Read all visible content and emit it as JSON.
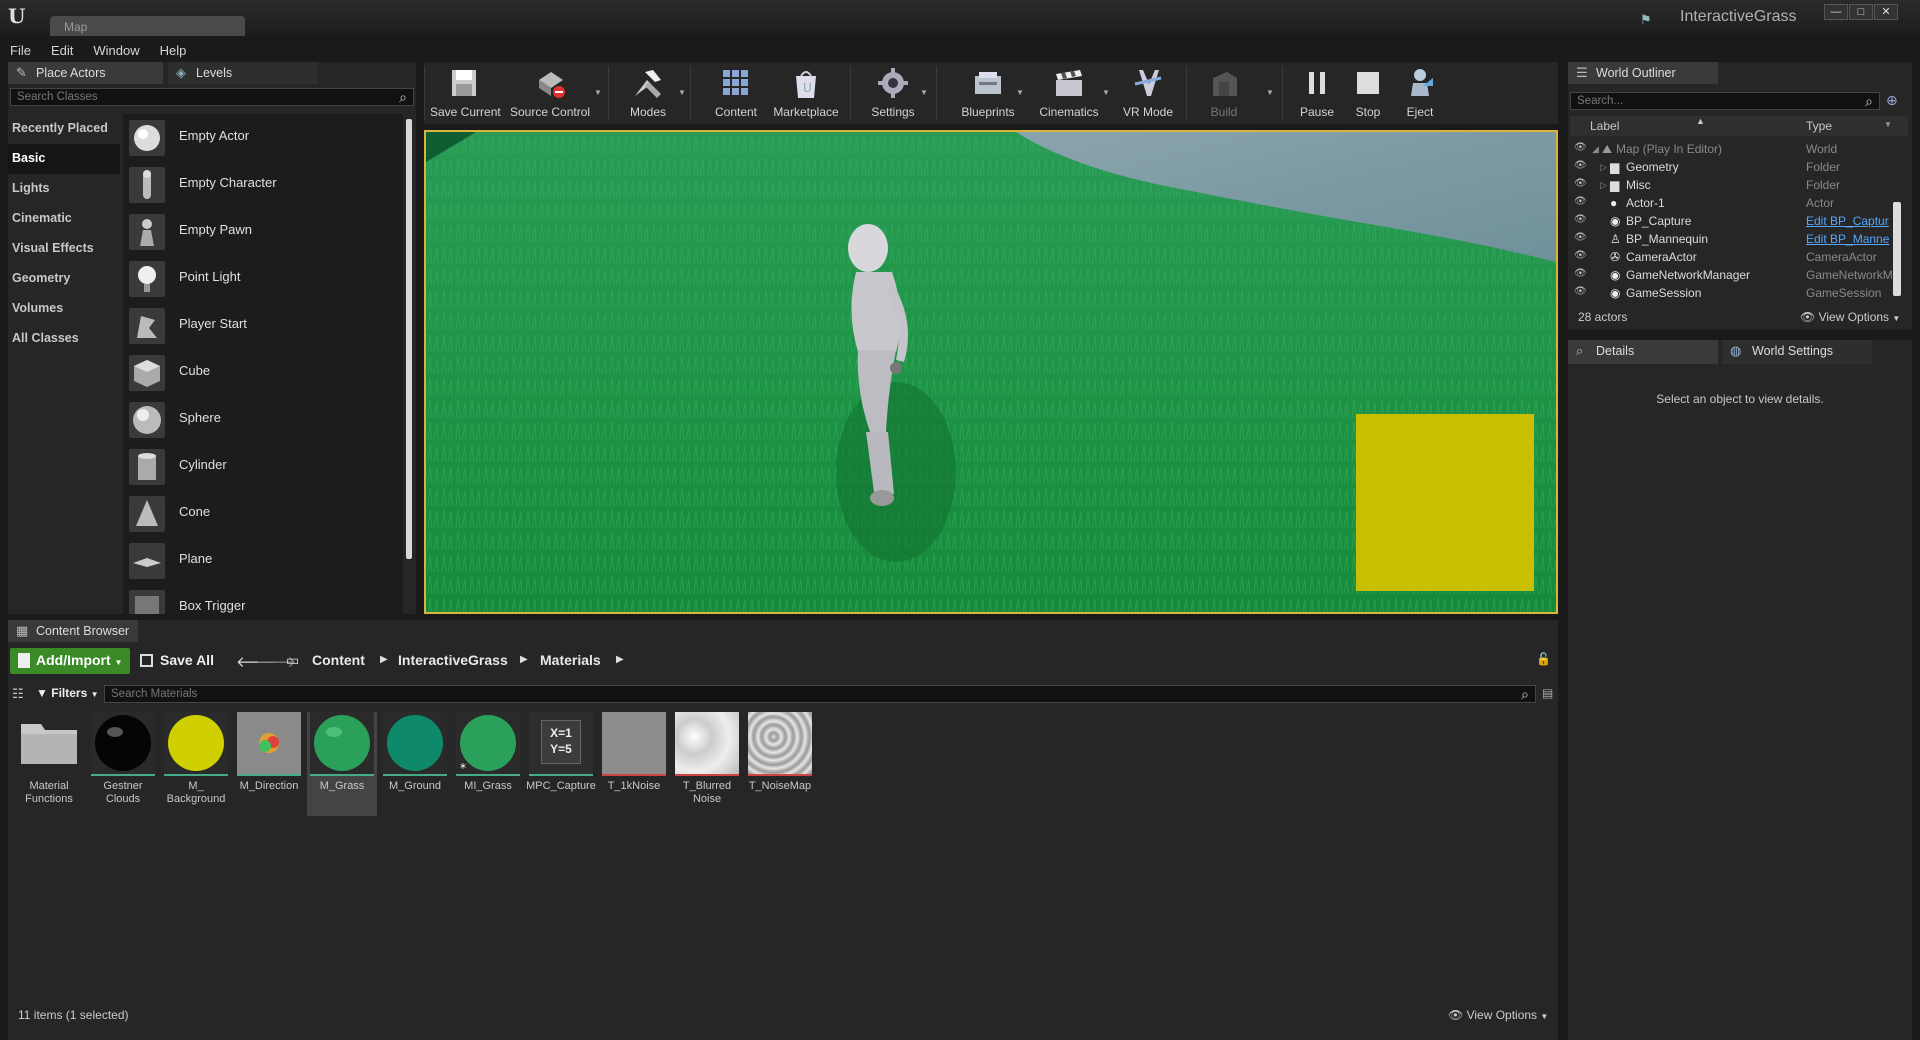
{
  "window": {
    "tab_title": "Map",
    "project_name": "InteractiveGrass",
    "controls": [
      "—",
      "□",
      "✕"
    ]
  },
  "menu": [
    "File",
    "Edit",
    "Window",
    "Help"
  ],
  "place_actors": {
    "tab_label": "Place Actors",
    "levels_tab_label": "Levels",
    "search_placeholder": "Search Classes",
    "categories": [
      "Recently Placed",
      "Basic",
      "Lights",
      "Cinematic",
      "Visual Effects",
      "Geometry",
      "Volumes",
      "All Classes"
    ],
    "active_category": "Basic",
    "actors": [
      "Empty Actor",
      "Empty Character",
      "Empty Pawn",
      "Point Light",
      "Player Start",
      "Cube",
      "Sphere",
      "Cylinder",
      "Cone",
      "Plane",
      "Box Trigger"
    ]
  },
  "toolbar": {
    "buttons": [
      "Save Current",
      "Source Control",
      "Modes",
      "Content",
      "Marketplace",
      "Settings",
      "Blueprints",
      "Cinematics",
      "VR Mode",
      "Build",
      "Pause",
      "Stop",
      "Eject"
    ]
  },
  "world_outliner": {
    "tab_label": "World Outliner",
    "search_placeholder": "Search...",
    "col_label": "Label",
    "col_type": "Type",
    "rows": [
      {
        "label": "Map (Play In Editor)",
        "type": "World"
      },
      {
        "label": "Geometry",
        "type": "Folder"
      },
      {
        "label": "Misc",
        "type": "Folder"
      },
      {
        "label": "Actor-1",
        "type": "Actor"
      },
      {
        "label": "BP_Capture",
        "type": "Edit BP_Captur"
      },
      {
        "label": "BP_Mannequin",
        "type": "Edit BP_Manne"
      },
      {
        "label": "CameraActor",
        "type": "CameraActor"
      },
      {
        "label": "GameNetworkManager",
        "type": "GameNetworkM"
      },
      {
        "label": "GameSession",
        "type": "GameSession"
      }
    ],
    "actor_count": "28 actors",
    "view_options": "View Options"
  },
  "details": {
    "tab_label": "Details",
    "world_settings_label": "World Settings",
    "empty_message": "Select an object to view details."
  },
  "content_browser": {
    "tab_label": "Content Browser",
    "add_import_label": "Add/Import",
    "save_all_label": "Save All",
    "breadcrumbs": [
      "Content",
      "InteractiveGrass",
      "Materials"
    ],
    "filters_label": "Filters",
    "search_placeholder": "Search Materials",
    "assets": [
      {
        "name": "Material Functions",
        "kind": "folder"
      },
      {
        "name": "Gestner Clouds",
        "kind": "black-sphere"
      },
      {
        "name": "M_ Background",
        "kind": "yellow-sphere"
      },
      {
        "name": "M_Direction",
        "kind": "direction"
      },
      {
        "name": "M_Grass",
        "kind": "green-sphere"
      },
      {
        "name": "M_Ground",
        "kind": "teal-sphere"
      },
      {
        "name": "MI_Grass",
        "kind": "green-sphere"
      },
      {
        "name": "MPC_Capture",
        "kind": "mpc"
      },
      {
        "name": "T_1kNoise",
        "kind": "noise"
      },
      {
        "name": "T_Blurred Noise",
        "kind": "blur-noise"
      },
      {
        "name": "T_NoiseMap",
        "kind": "noise-map"
      }
    ],
    "mpc_text": "X=1\nY=5",
    "status": "11 items (1 selected)",
    "view_options": "View Options"
  },
  "colors": {
    "accent_green": "#3a8a28",
    "viewport_border": "#d8b43a",
    "link_blue": "#55a6ff",
    "overlay_yellow": "#c8bf00"
  }
}
